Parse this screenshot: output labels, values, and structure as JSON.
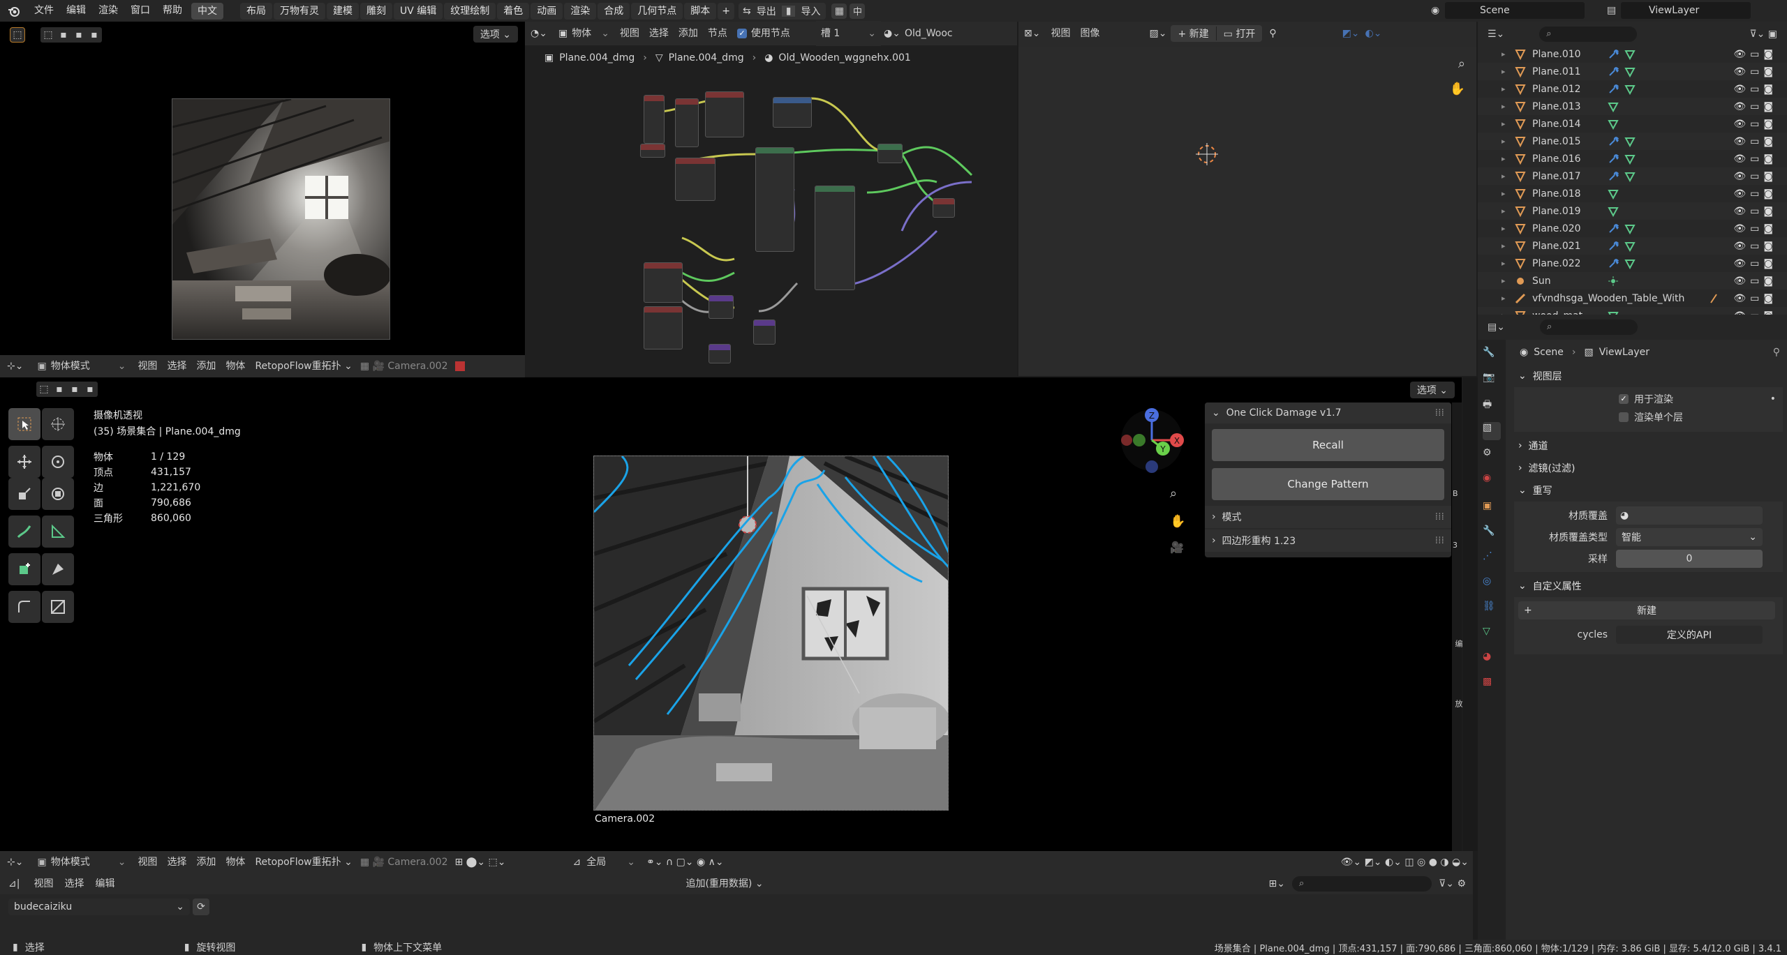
{
  "topbar": {
    "menus": [
      "文件",
      "编辑",
      "渲染",
      "窗口",
      "帮助"
    ],
    "lang_btn": "中文",
    "workspaces": [
      "布局",
      "万物有灵",
      "建模",
      "雕刻",
      "UV 编辑",
      "纹理绘制",
      "着色",
      "动画",
      "渲染",
      "合成",
      "几何节点",
      "脚本"
    ],
    "export_label": "导出",
    "import_label": "导入",
    "zh_label": "中",
    "scene": "Scene",
    "view_layer": "ViewLayer"
  },
  "preview_viewport": {
    "options": "选项",
    "mode": "物体模式",
    "menus": [
      "视图",
      "选择",
      "添加",
      "物体"
    ],
    "addon": "RetopoFlow重拓扑",
    "camera": "Camera.002"
  },
  "node_editor": {
    "type": "物体",
    "menus": [
      "视图",
      "选择",
      "添加",
      "节点"
    ],
    "use_nodes": "使用节点",
    "slot": "槽 1",
    "material": "Old_Wooc",
    "breadcrumb": [
      "Plane.004_dmg",
      "Plane.004_dmg",
      "Old_Wooden_wggnehx.001"
    ]
  },
  "image_editor": {
    "menus": [
      "视图",
      "图像"
    ],
    "new_label": "新建",
    "open_label": "打开"
  },
  "outliner": {
    "items": [
      {
        "name": "Plane.010",
        "type": "mesh",
        "mod": true
      },
      {
        "name": "Plane.011",
        "type": "mesh",
        "mod": true
      },
      {
        "name": "Plane.012",
        "type": "mesh",
        "mod": true
      },
      {
        "name": "Plane.013",
        "type": "mesh",
        "mod": false
      },
      {
        "name": "Plane.014",
        "type": "mesh",
        "mod": false
      },
      {
        "name": "Plane.015",
        "type": "mesh",
        "mod": true
      },
      {
        "name": "Plane.016",
        "type": "mesh",
        "mod": true
      },
      {
        "name": "Plane.017",
        "type": "mesh",
        "mod": true
      },
      {
        "name": "Plane.018",
        "type": "mesh",
        "mod": false
      },
      {
        "name": "Plane.019",
        "type": "mesh",
        "mod": false
      },
      {
        "name": "Plane.020",
        "type": "mesh",
        "mod": true
      },
      {
        "name": "Plane.021",
        "type": "mesh",
        "mod": true
      },
      {
        "name": "Plane.022",
        "type": "mesh",
        "mod": true
      },
      {
        "name": "Sun",
        "type": "light",
        "mod": false
      },
      {
        "name": "vfvndhsga_Wooden_Table_With",
        "type": "armature",
        "mod": false
      },
      {
        "name": "wood_mat",
        "type": "mesh",
        "mod": false
      }
    ]
  },
  "properties": {
    "breadcrumb_scene": "Scene",
    "breadcrumb_layer": "ViewLayer",
    "view_layer_section": "视图层",
    "use_for_render": "用于渲染",
    "render_single_layer": "渲染单个层",
    "passes": "通道",
    "filter": "滤镜(过滤)",
    "override": "重写",
    "mat_override_label": "材质覆盖",
    "mat_override_type_label": "材质覆盖类型",
    "mat_override_type_value": "智能",
    "samples_label": "采样",
    "samples_value": "0",
    "custom_props": "自定义属性",
    "new_label": "新建",
    "cycles_label": "cycles",
    "cycles_value": "定义的API"
  },
  "main_viewport": {
    "options": "选项",
    "title": "摄像机透视",
    "subtitle": "(35) 场景集合 | Plane.004_dmg",
    "stats": [
      {
        "k": "物体",
        "v": "1 / 129"
      },
      {
        "k": "顶点",
        "v": "431,157"
      },
      {
        "k": "边",
        "v": "1,221,670"
      },
      {
        "k": "面",
        "v": "790,686"
      },
      {
        "k": "三角形",
        "v": "860,060"
      }
    ],
    "camera_label": "Camera.002",
    "addon_panel": {
      "title": "One Click Damage v1.7",
      "recall": "Recall",
      "change_pattern": "Change Pattern",
      "mode": "模式",
      "quad_remesh": "四边形重构 1.23"
    },
    "side_tabs": [
      "B",
      "3",
      "编",
      "放"
    ]
  },
  "viewport_header": {
    "mode": "物体模式",
    "menus": [
      "视图",
      "选择",
      "添加",
      "物体"
    ],
    "addon": "RetopoFlow重拓扑",
    "camera": "Camera.002",
    "transform": "全局"
  },
  "asset_browser": {
    "menus": [
      "视图",
      "选择",
      "编辑"
    ],
    "import_mode": "追加(重用数据)",
    "library": "budecaiziku"
  },
  "statusbar": {
    "select": "选择",
    "rotate": "旋转视图",
    "context_menu": "物体上下文菜单",
    "info": "场景集合 | Plane.004_dmg | 顶点:431,157 | 面:790,686 | 三角面:860,060 | 物体:1/129 | 内存: 3.86 GiB | 显存: 5.4/12.0 GiB | 3.4.1"
  },
  "colors": {
    "accent": "#4772b3",
    "outline_blue": "#1aa3e8",
    "mesh_orange": "#e09a55",
    "mesh_green": "#5cc98a",
    "wire_yellow": "#c8c850",
    "wire_green": "#5ec95e",
    "wire_purple": "#7a6fc9",
    "wire_gray": "#9a9a9a"
  }
}
